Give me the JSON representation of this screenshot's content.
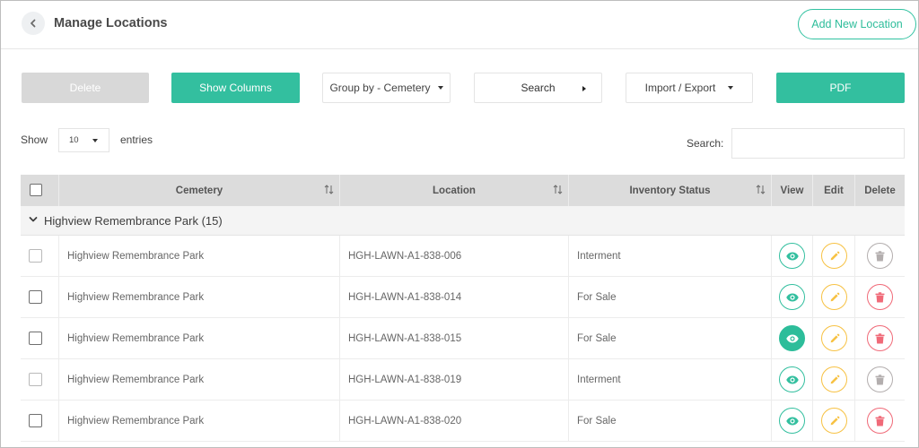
{
  "header": {
    "title": "Manage Locations",
    "add_button": "Add New Location"
  },
  "toolbar": {
    "delete": "Delete",
    "show_columns": "Show Columns",
    "group_by": "Group by - Cemetery",
    "search": "Search",
    "import_export": "Import / Export",
    "pdf": "PDF"
  },
  "entries": {
    "show_label": "Show",
    "value": "10",
    "entries_label": "entries",
    "search_label": "Search:",
    "search_value": ""
  },
  "table": {
    "columns": [
      "Cemetery",
      "Location",
      "Inventory Status",
      "View",
      "Edit",
      "Delete"
    ],
    "group_label": "Highview Remembrance Park (15)",
    "rows": [
      {
        "cemetery": "Highview Remembrance Park",
        "location": "HGH-LAWN-A1-838-006",
        "status": "Interment"
      },
      {
        "cemetery": "Highview Remembrance Park",
        "location": "HGH-LAWN-A1-838-014",
        "status": "For Sale"
      },
      {
        "cemetery": "Highview Remembrance Park",
        "location": "HGH-LAWN-A1-838-015",
        "status": "For Sale"
      },
      {
        "cemetery": "Highview Remembrance Park",
        "location": "HGH-LAWN-A1-838-019",
        "status": "Interment"
      },
      {
        "cemetery": "Highview Remembrance Park",
        "location": "HGH-LAWN-A1-838-020",
        "status": "For Sale"
      }
    ]
  },
  "colors": {
    "accent": "#33bf9f",
    "edit": "#f7c244",
    "delete_active": "#f06a78",
    "delete_muted": "#b3aeae"
  },
  "icons": [
    "back-arrow-icon",
    "sort-icon",
    "chevron-down-icon",
    "eye-icon",
    "pencil-icon",
    "trash-icon"
  ]
}
